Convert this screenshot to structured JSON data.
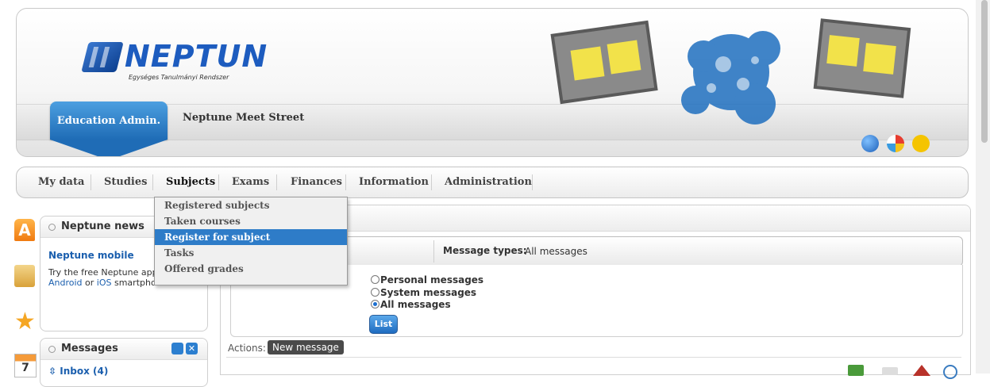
{
  "header": {
    "logo_title": "NEPTUN",
    "logo_subtitle": "Egységes Tanulmányi Rendszer",
    "education_tab": "Education Admin.",
    "site_name": "Neptune Meet Street"
  },
  "nav": {
    "items": [
      {
        "label": "My data"
      },
      {
        "label": "Studies"
      },
      {
        "label": "Subjects"
      },
      {
        "label": "Exams"
      },
      {
        "label": "Finances"
      },
      {
        "label": "Information"
      },
      {
        "label": "Administration"
      }
    ],
    "active_index": 2
  },
  "dropdown": {
    "items": [
      "Registered subjects",
      "Taken courses",
      "Register for subject",
      "Tasks",
      "Offered grades"
    ],
    "selected_index": 2
  },
  "news": {
    "title": "Neptune news",
    "headline": "Neptune mobile",
    "body_line1": "Try the free Neptune app",
    "body_line2_prefix": "",
    "android_link": "Android",
    "or_text": " or ",
    "ios_link": "iOS",
    "body_line2_suffix": " smartpho"
  },
  "messages_box": {
    "title": "Messages",
    "inbox_label": "Inbox (4)"
  },
  "filter": {
    "message_types_label": "Message types:",
    "message_types_value": "All messages",
    "options": [
      "Personal messages",
      "System messages",
      "All messages"
    ],
    "selected_index": 2,
    "list_button": "List"
  },
  "actions": {
    "label": "Actions:",
    "new_message_button": "New message"
  },
  "colors": {
    "accent_blue": "#2e7cc8",
    "logo_blue": "#1d5cbf"
  }
}
